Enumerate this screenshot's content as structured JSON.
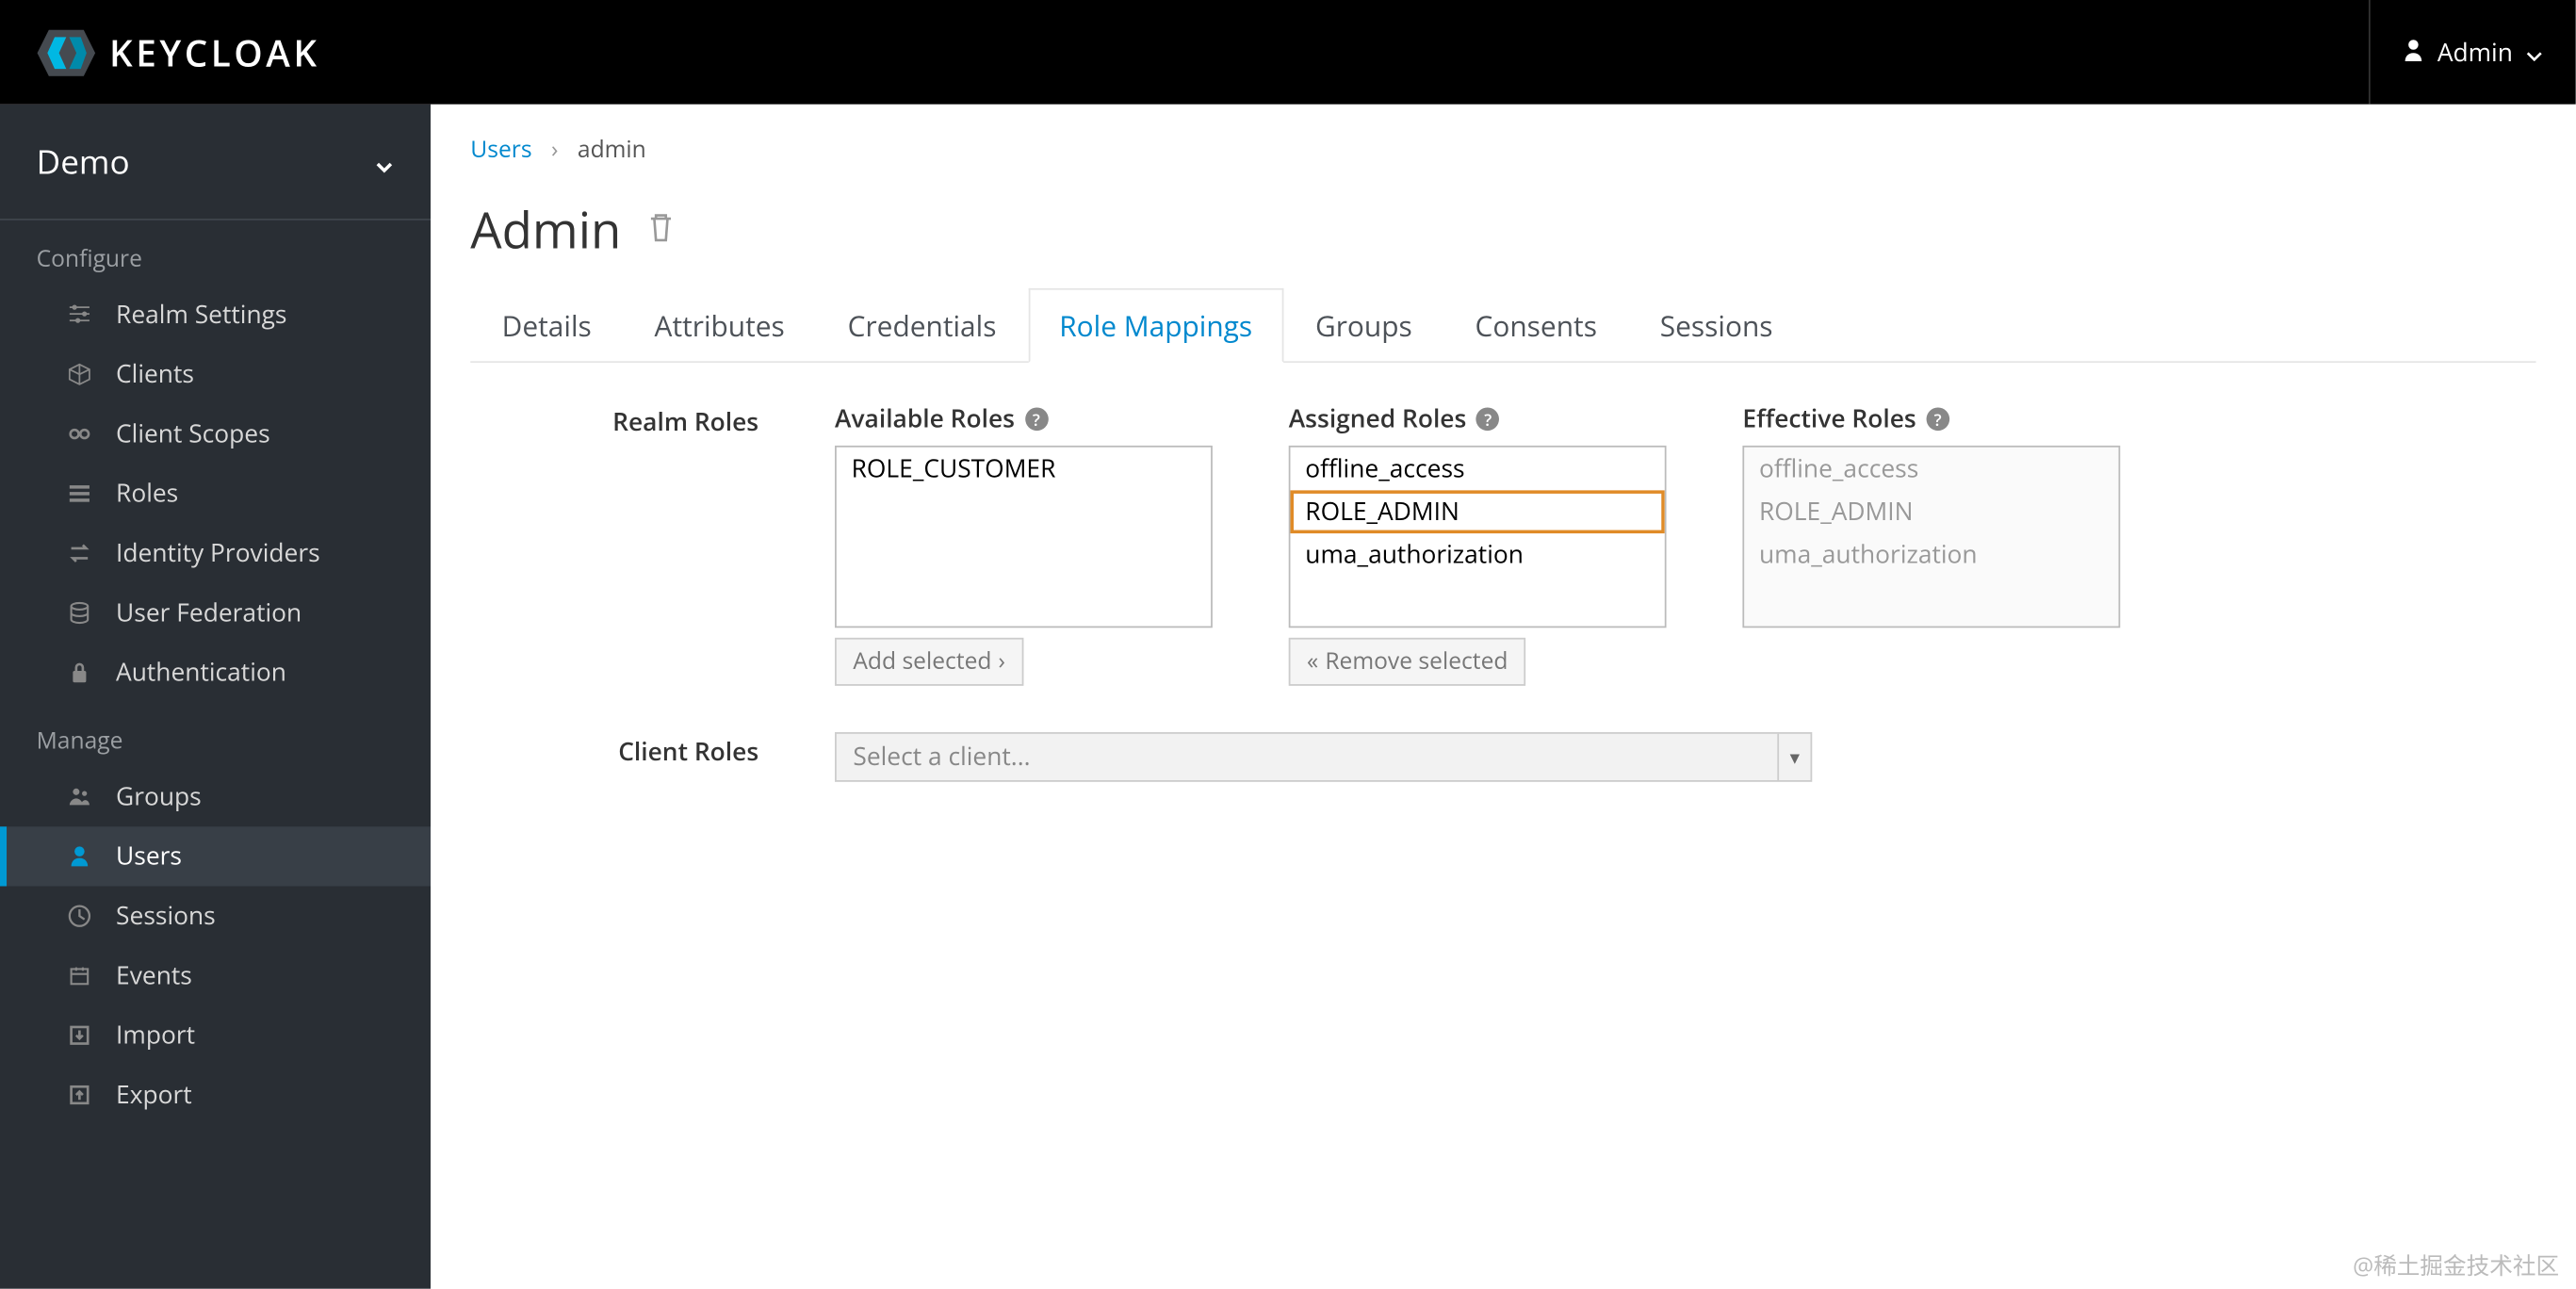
{
  "header": {
    "brand": "KEYCLOAK",
    "user_label": "Admin"
  },
  "sidebar": {
    "realm": "Demo",
    "configure_label": "Configure",
    "manage_label": "Manage",
    "configure": [
      {
        "key": "realm-settings",
        "label": "Realm Settings",
        "icon": "sliders"
      },
      {
        "key": "clients",
        "label": "Clients",
        "icon": "cube"
      },
      {
        "key": "client-scopes",
        "label": "Client Scopes",
        "icon": "chain"
      },
      {
        "key": "roles",
        "label": "Roles",
        "icon": "list"
      },
      {
        "key": "identity-providers",
        "label": "Identity Providers",
        "icon": "exchange"
      },
      {
        "key": "user-federation",
        "label": "User Federation",
        "icon": "database"
      },
      {
        "key": "authentication",
        "label": "Authentication",
        "icon": "lock"
      }
    ],
    "manage": [
      {
        "key": "groups",
        "label": "Groups",
        "icon": "users"
      },
      {
        "key": "users",
        "label": "Users",
        "icon": "user",
        "active": true
      },
      {
        "key": "sessions",
        "label": "Sessions",
        "icon": "clock"
      },
      {
        "key": "events",
        "label": "Events",
        "icon": "calendar"
      },
      {
        "key": "import",
        "label": "Import",
        "icon": "import"
      },
      {
        "key": "export",
        "label": "Export",
        "icon": "export"
      }
    ]
  },
  "breadcrumb": {
    "parent": "Users",
    "current": "admin"
  },
  "page": {
    "title": "Admin"
  },
  "tabs": [
    {
      "key": "details",
      "label": "Details"
    },
    {
      "key": "attributes",
      "label": "Attributes"
    },
    {
      "key": "credentials",
      "label": "Credentials"
    },
    {
      "key": "role-mappings",
      "label": "Role Mappings",
      "active": true
    },
    {
      "key": "groups",
      "label": "Groups"
    },
    {
      "key": "consents",
      "label": "Consents"
    },
    {
      "key": "sessions",
      "label": "Sessions"
    }
  ],
  "role_mappings": {
    "realm_roles_label": "Realm Roles",
    "available_label": "Available Roles",
    "assigned_label": "Assigned Roles",
    "effective_label": "Effective Roles",
    "available": [
      "ROLE_CUSTOMER"
    ],
    "assigned": [
      {
        "name": "offline_access",
        "selected": false
      },
      {
        "name": "ROLE_ADMIN",
        "selected": true
      },
      {
        "name": "uma_authorization",
        "selected": false
      }
    ],
    "effective": [
      "offline_access",
      "ROLE_ADMIN",
      "uma_authorization"
    ],
    "add_selected_label": "Add selected",
    "remove_selected_label": "Remove selected",
    "client_roles_label": "Client Roles",
    "client_select_placeholder": "Select a client..."
  },
  "watermark": "@稀土掘金技术社区"
}
